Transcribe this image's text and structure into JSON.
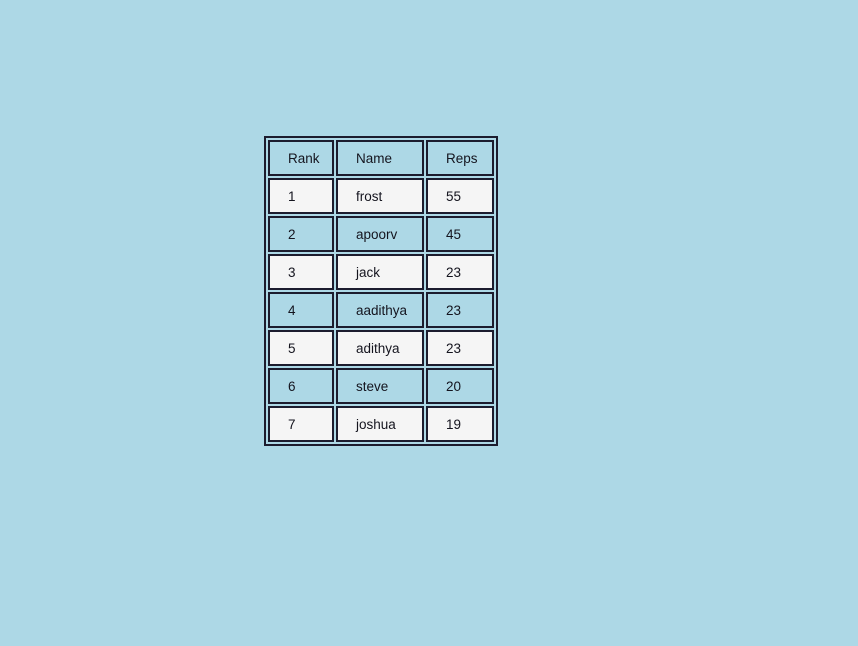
{
  "page": {
    "background_color": "#add8e6"
  },
  "table": {
    "name": "leaderboard-table",
    "border_color": "#1c1c2e",
    "header_background": "#add8e6",
    "row_background_odd": "#f5f5f5",
    "row_background_even": "#add8e6",
    "columns": [
      {
        "key": "rank",
        "label": "Rank"
      },
      {
        "key": "name",
        "label": "Name"
      },
      {
        "key": "reps",
        "label": "Reps"
      }
    ],
    "rows": [
      {
        "rank": "1",
        "name": "frost",
        "reps": "55"
      },
      {
        "rank": "2",
        "name": "apoorv",
        "reps": "45"
      },
      {
        "rank": "3",
        "name": "jack",
        "reps": "23"
      },
      {
        "rank": "4",
        "name": "aadithya",
        "reps": "23"
      },
      {
        "rank": "5",
        "name": "adithya",
        "reps": "23"
      },
      {
        "rank": "6",
        "name": "steve",
        "reps": "20"
      },
      {
        "rank": "7",
        "name": "joshua",
        "reps": "19"
      }
    ]
  }
}
